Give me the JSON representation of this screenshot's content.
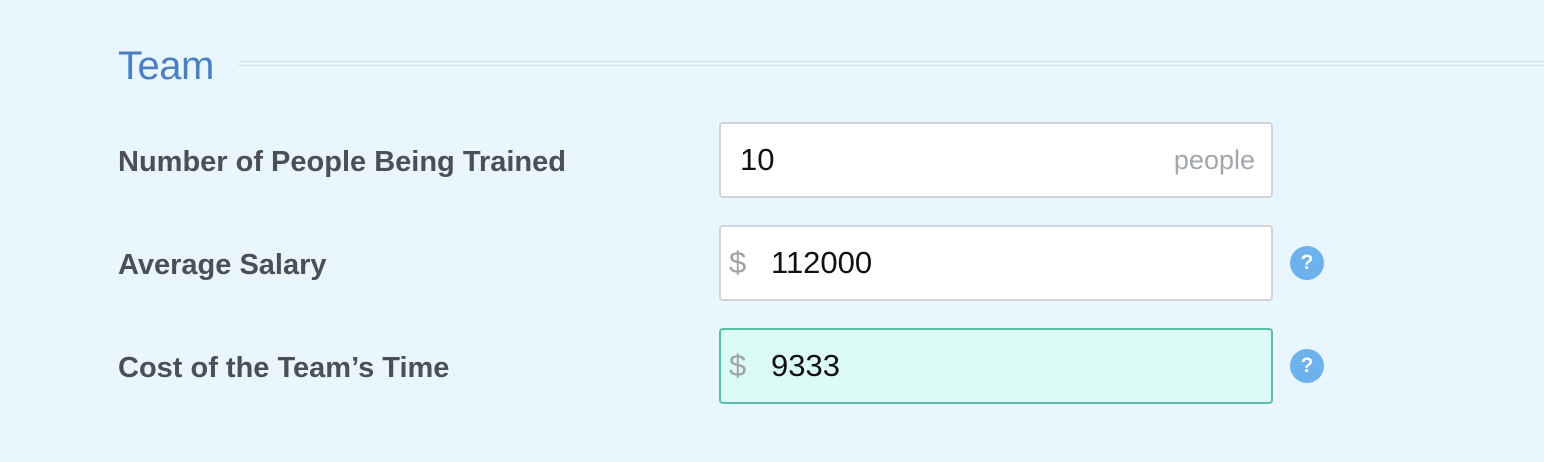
{
  "section": {
    "title": "Team"
  },
  "rows": [
    {
      "label": "Number of People Being Trained",
      "value": "10",
      "prefix": "",
      "suffix": "people",
      "has_help": false
    },
    {
      "label": "Average Salary",
      "value": "112000",
      "prefix": "$",
      "suffix": "",
      "has_help": true
    },
    {
      "label": "Cost of the Team’s Time",
      "value": "9333",
      "prefix": "$",
      "suffix": "",
      "has_help": true,
      "computed": true
    }
  ],
  "help_icon_glyph": "?",
  "colors": {
    "background": "#eaf6fd",
    "section_title": "#4a7fc4",
    "label_text": "#4b4f58",
    "input_border": "#d0d4d8",
    "computed_background": "#dcfbf6",
    "computed_border": "#5bbfa6",
    "help_icon": "#6db2ec"
  },
  "icons": {
    "help": "question-circle-icon"
  }
}
